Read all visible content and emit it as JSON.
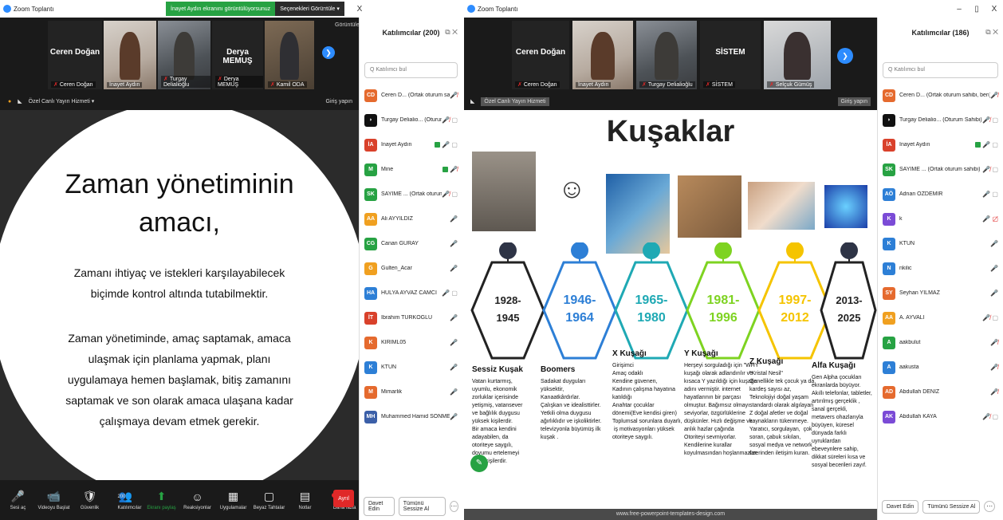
{
  "colors": {
    "zoom_blue": "#2d8cff",
    "green": "#27a243",
    "red": "#e02828"
  },
  "w1": {
    "title": "Zoom Toplantı",
    "share_notice": "İnayet Aydın ekranını görüntülüyorsunuz",
    "view_options": "Seçenekleri Görüntüle",
    "controls": [
      "–",
      "▯",
      "X"
    ],
    "strip": {
      "tiles": [
        {
          "name": "Ceren Doğan",
          "tag": "Ceren Doğan",
          "video": false
        },
        {
          "name": "",
          "tag": "İnayet Aydın",
          "video": true
        },
        {
          "name": "",
          "tag": "Turgay Delialioğlu",
          "video": true
        },
        {
          "name": "Derya MEMUŞ",
          "tag": "Derya MEMUŞ",
          "video": false
        },
        {
          "name": "",
          "tag": "Kamil ODA",
          "video": true
        }
      ],
      "view_label": "Görüntüle"
    },
    "slidebar": {
      "menu": "Özel Canlı Yayın Hizmeti",
      "right": "Giriş yapın"
    },
    "slide": {
      "title1": "Zaman yönetiminin",
      "title2": "amacı,",
      "p1a": "Zamanı ihtiyaç ve istekleri karşılayabilecek",
      "p1b": "biçimde kontrol altında tutabilmektir.",
      "p2a": "Zaman yönetiminde, amaç saptamak, amaca",
      "p2b": "ulaşmak için planlama yapmak, planı",
      "p2c": "uygulamaya hemen başlamak, bitiş zamanını",
      "p2d": "saptamak ve son olarak amaca ulaşana kadar",
      "p2e": "çalışmaya devam   etmek   gerekir."
    },
    "toolbar": [
      {
        "icon": "mic-muted-icon",
        "glyph": "🎤",
        "label": "Sesi aç"
      },
      {
        "icon": "video-off-icon",
        "glyph": "📹",
        "label": "Videoyu Başlat"
      },
      {
        "icon": "shield-icon",
        "glyph": "🛡",
        "label": "Güvenlik"
      },
      {
        "icon": "participants-icon",
        "glyph": "👥",
        "label": "Katılımcılar",
        "count": "200"
      },
      {
        "icon": "share-screen-icon",
        "glyph": "⬆",
        "label": "Ekranı paylaş",
        "green": true
      },
      {
        "icon": "reactions-icon",
        "glyph": "☺",
        "label": "Reaksiyonlar"
      },
      {
        "icon": "apps-icon",
        "glyph": "▦",
        "label": "Uygulamalar"
      },
      {
        "icon": "whiteboard-icon",
        "glyph": "▢",
        "label": "Beyaz Tahtalar"
      },
      {
        "icon": "notes-icon",
        "glyph": "▤",
        "label": "Notlar"
      },
      {
        "icon": "more-icon",
        "glyph": "•••",
        "label": "Daha fazla",
        "badge": "1"
      }
    ],
    "end": "Ayrıl",
    "panel": {
      "title": "Katılımcılar (200)",
      "search": "Q Katılımcı bul",
      "invite": "Davet Edin",
      "mute_all": "Tümünü Sessize Al",
      "more": "···",
      "rows": [
        {
          "av": "CD",
          "c": "#e56a2e",
          "name": "Ceren D... (Ortak oturum sahibi, ben)",
          "icons": "mic-off"
        },
        {
          "av": "◗",
          "c": "#111",
          "name": "Turgay Delialio... (Oturum Sahibi)",
          "icons": "mic-off-cam"
        },
        {
          "av": "İA",
          "c": "#d9412b",
          "name": "İnayet Aydın",
          "icons": "share-mic-cam"
        },
        {
          "av": "M",
          "c": "#27a243",
          "name": "Mine",
          "icons": "share-mic-off"
        },
        {
          "av": "SK",
          "c": "#27a243",
          "name": "SAYİME ... (Ortak oturum sahibi)",
          "icons": "mic-off-cam"
        },
        {
          "av": "AA",
          "c": "#f0a020",
          "name": "Ali AYYILDIZ",
          "icons": "mic"
        },
        {
          "av": "CG",
          "c": "#27a243",
          "name": "Canan GÜRAY",
          "icons": "mic"
        },
        {
          "av": "G",
          "c": "#f0a020",
          "name": "Gulten_Acar",
          "icons": "mic"
        },
        {
          "av": "HA",
          "c": "#2d7fd6",
          "name": "HÜLYA AYVAZ CAMCI",
          "icons": "mic-cam"
        },
        {
          "av": "İT",
          "c": "#d9412b",
          "name": "İbrahim TÜRKOĞLU",
          "icons": "mic"
        },
        {
          "av": "K",
          "c": "#e56a2e",
          "name": "KIRIML05",
          "icons": "mic"
        },
        {
          "av": "K",
          "c": "#2d7fd6",
          "name": "KTUN",
          "icons": "mic"
        },
        {
          "av": "M",
          "c": "#e56a2e",
          "name": "Mimarlik",
          "icons": "mic"
        },
        {
          "av": "MH",
          "c": "#3b5fa8",
          "name": "Muhammed Hamid SÖNMEZ",
          "icons": "mic"
        }
      ]
    }
  },
  "w2": {
    "title": "Zoom Toplantı",
    "controls": [
      "–",
      "▯",
      "X"
    ],
    "strip": {
      "tiles": [
        {
          "name": "Ceren Doğan",
          "tag": "Ceren Doğan",
          "video": false
        },
        {
          "name": "",
          "tag": "İnayet Aydın",
          "video": true
        },
        {
          "name": "",
          "tag": "Turgay Delialioğlu",
          "video": true
        },
        {
          "name": "SİSTEM",
          "tag": "SİSTEM",
          "video": false
        },
        {
          "name": "",
          "tag": "Selçuk Gümüş",
          "video": true
        }
      ]
    },
    "slidebar": {
      "menu": "Özel Canlı Yayın Hizmeti",
      "right": "Giriş yapın"
    },
    "slide": {
      "title": "Kuşaklar",
      "hex": [
        "1928-\n1945",
        "1946-\n1964",
        "1965-\n1980",
        "1981-\n1996",
        "1997-\n2012",
        "2013-\n2025"
      ],
      "cols": [
        {
          "t": "Sessiz Kuşak",
          "b": "Vatan kurtarmış,\nuyumlu, ekonomik\nzorluklar içerisinde\nyetişmiş, vatansever\nve bağlılık duygusu\nyüksek kişilerdir.\nBir amaca kendini\nadayabilen, da\notoriteye saygılı,\ndoyumu ertelemeyi\nbilen kişilerdir."
        },
        {
          "t": "Boomers",
          "b": "Sadakat duyguları\nyüksektir,\nKanaatkârdırlar.\nÇalışkan ve idealisttirler.\nYetkili olma duygusu\nağırlıklıdır ve işkoliktirler.\ntelevizyonla büyümüş ilk\nkuşak ."
        },
        {
          "t": "X Kuşağı",
          "b": "Girişimci\nAmaç odaklı\nKendine güvenen,\nKadının çalışma hayatına\nkatıldığı\nAnahtar çocuklar\ndönemi(Eve kendisi giren)\nToplumsal sorunlara duyarlı,\n iş motivasyonları yüksek\notoriteye saygılı."
        },
        {
          "t": "Y Kuşağı",
          "b": "Herşeyi sorguladığı için \"WHY\"\nkuşağı olarak adlandırılır ve\nkısaca Y yazıldığı için kuşağa\nadını vermiştir. internet\nhayatlarının bir parçası\nolmuştur. Bağımsız olmayı\nseviyorlar, özgürlüklerine\ndüşkünler. Hızlı değişme ve\nanlık hazlar çağında\nOtoriteyi sevmiyorlar.\nKendilerine kurallar\nkoyulmasından hoşlanmazlar."
        },
        {
          "t": "Z Kuşağı",
          "b": "\"Kristal Nesil\"\nGenellikle tek çocuk ya da\nkardeş sayısı az,\nTeknolojiyi doğal yaşam\nstandardı olarak algılayan\nZ doğal afetler ve doğal\nkaynakların tükenmeye.\nYaratıcı, sorgulayan,  çok\nsoran, çabuk sıkılan,\nsosyal medya ve network\nüzerinden iletişim kuran."
        },
        {
          "t": "Alfa Kuşağı",
          "b": "Gen Alpha çocukları\nekranlarda büyüyor.\nAkıllı telefonlar, tabletler,\nartırılmış gerçeklik ,\nsanal gerçekli,\nmetavers ohazlarıyla\nbüyüyen, küresel\ndünyada farklı\nuyruklardan\nebeveynlere sahip,\ndikkat süreleri kısa ve\nsosyal becerileri zayıf."
        }
      ],
      "footer": "www.free-powerpoint-templates-design.com"
    },
    "panel": {
      "title": "Katılımcılar (186)",
      "search": "Q Katılımcı bul",
      "invite": "Davet Edin",
      "mute_all": "Tümünü Sessize Al",
      "more": "···",
      "rows": [
        {
          "av": "CD",
          "c": "#e56a2e",
          "name": "Ceren D... (Ortak oturum sahibi, ben)",
          "icons": "mic-off"
        },
        {
          "av": "◗",
          "c": "#111",
          "name": "Turgay Delialio... (Oturum Sahibi)",
          "icons": "mic-off-cam"
        },
        {
          "av": "İA",
          "c": "#d9412b",
          "name": "İnayet Aydın",
          "icons": "share-mic-cam"
        },
        {
          "av": "SK",
          "c": "#27a243",
          "name": "SAYİME ... (Ortak oturum sahibi)",
          "icons": "mic-off-cam"
        },
        {
          "av": "AÖ",
          "c": "#2d7fd6",
          "name": "Adnan ÖZDEMİR",
          "icons": "mic-cam"
        },
        {
          "av": "K",
          "c": "#7b4bd6",
          "name": "k",
          "icons": "mic-cam-off"
        },
        {
          "av": "K",
          "c": "#2d7fd6",
          "name": "KTUN",
          "icons": "mic"
        },
        {
          "av": "N",
          "c": "#2d7fd6",
          "name": "nkilic",
          "icons": "mic"
        },
        {
          "av": "SY",
          "c": "#e56a2e",
          "name": "Seyhan YILMAZ",
          "icons": "mic"
        },
        {
          "av": "AA",
          "c": "#f0a020",
          "name": "A. AYVALI",
          "icons": "mic-off-cam"
        },
        {
          "av": "A",
          "c": "#27a243",
          "name": "aakbulut",
          "icons": "mic-off"
        },
        {
          "av": "A",
          "c": "#2d7fd6",
          "name": "aakusta",
          "icons": "mic-off"
        },
        {
          "av": "AD",
          "c": "#e56a2e",
          "name": "Abdullah DENİZ",
          "icons": "mic-off"
        },
        {
          "av": "AK",
          "c": "#7b4bd6",
          "name": "Abdullah KAYA",
          "icons": "mic-off-cam"
        }
      ]
    }
  }
}
